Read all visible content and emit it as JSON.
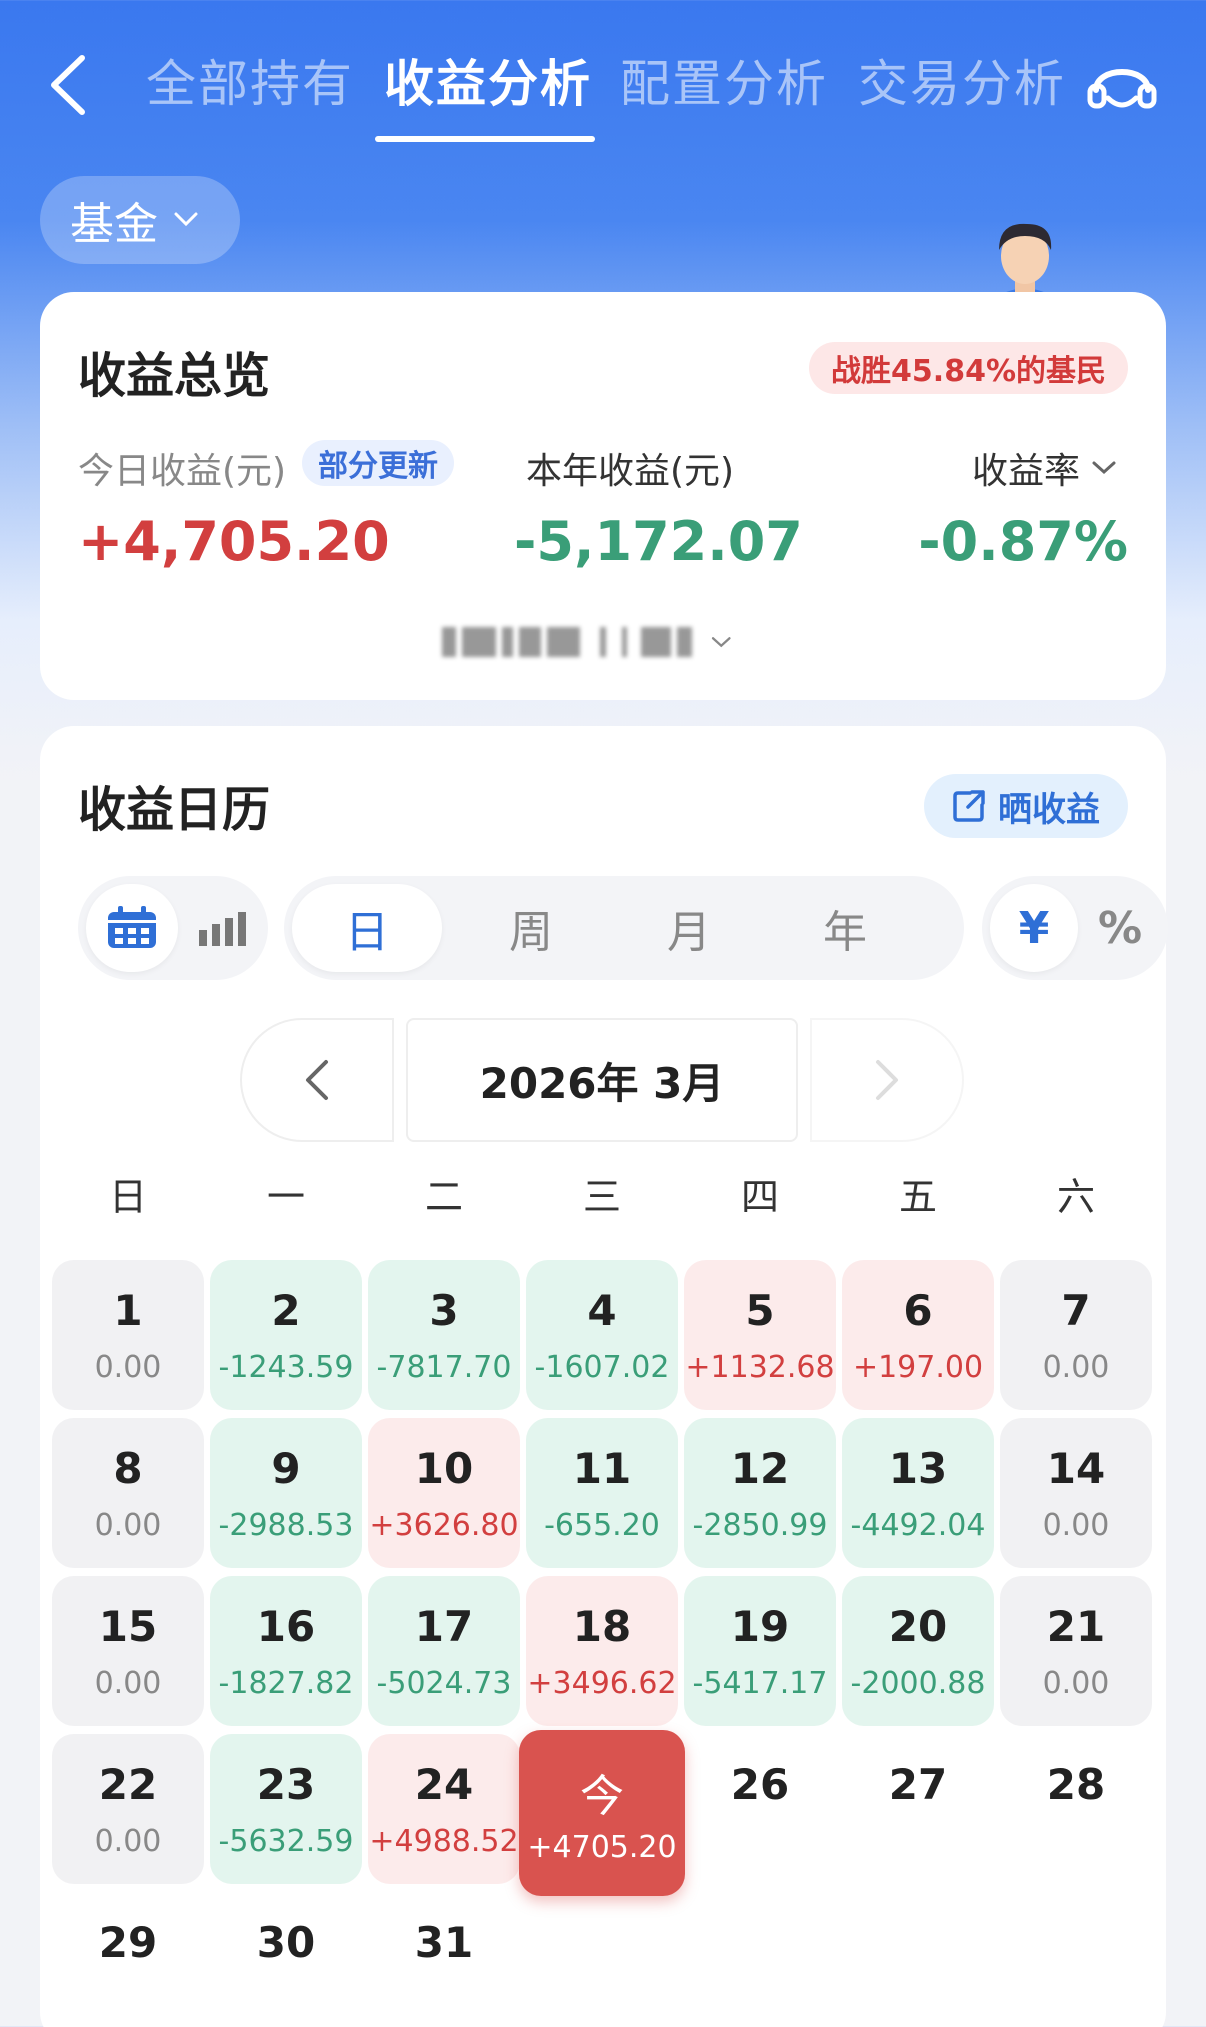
{
  "nav": {
    "tabs": [
      {
        "label": "全部持有",
        "active": false
      },
      {
        "label": "收益分析",
        "active": true
      },
      {
        "label": "配置分析",
        "active": false
      },
      {
        "label": "交易分析",
        "active": false
      }
    ],
    "icons": {
      "back": "chevron-left-icon",
      "service": "headset-icon"
    }
  },
  "filter": {
    "label": "基金"
  },
  "overview": {
    "title": "收益总览",
    "beat_badge": "战胜45.84%的基民",
    "today": {
      "label": "今日收益(元)",
      "badge": "部分更新",
      "value": "+4,705.20"
    },
    "year": {
      "label": "本年收益(元)",
      "value": "-5,172.07"
    },
    "rate": {
      "label": "收益率",
      "value": "-0.87%"
    }
  },
  "calendar": {
    "title": "收益日历",
    "share_label": "晒收益",
    "view_icons": [
      "calendar-icon",
      "bar-chart-icon"
    ],
    "periods": [
      "日",
      "周",
      "月",
      "年"
    ],
    "units": [
      "¥",
      "%"
    ],
    "month_label": "2026年 3月",
    "weekdays": [
      "日",
      "一",
      "二",
      "三",
      "四",
      "五",
      "六"
    ],
    "days": [
      {
        "d": "1",
        "v": "0.00",
        "t": "zero"
      },
      {
        "d": "2",
        "v": "-1243.59",
        "t": "loss"
      },
      {
        "d": "3",
        "v": "-7817.70",
        "t": "loss"
      },
      {
        "d": "4",
        "v": "-1607.02",
        "t": "loss"
      },
      {
        "d": "5",
        "v": "+1132.68",
        "t": "gain"
      },
      {
        "d": "6",
        "v": "+197.00",
        "t": "gain"
      },
      {
        "d": "7",
        "v": "0.00",
        "t": "zero"
      },
      {
        "d": "8",
        "v": "0.00",
        "t": "zero"
      },
      {
        "d": "9",
        "v": "-2988.53",
        "t": "loss"
      },
      {
        "d": "10",
        "v": "+3626.80",
        "t": "gain"
      },
      {
        "d": "11",
        "v": "-655.20",
        "t": "loss"
      },
      {
        "d": "12",
        "v": "-2850.99",
        "t": "loss"
      },
      {
        "d": "13",
        "v": "-4492.04",
        "t": "loss"
      },
      {
        "d": "14",
        "v": "0.00",
        "t": "zero"
      },
      {
        "d": "15",
        "v": "0.00",
        "t": "zero"
      },
      {
        "d": "16",
        "v": "-1827.82",
        "t": "loss"
      },
      {
        "d": "17",
        "v": "-5024.73",
        "t": "loss"
      },
      {
        "d": "18",
        "v": "+3496.62",
        "t": "gain"
      },
      {
        "d": "19",
        "v": "-5417.17",
        "t": "loss"
      },
      {
        "d": "20",
        "v": "-2000.88",
        "t": "loss"
      },
      {
        "d": "21",
        "v": "0.00",
        "t": "zero"
      },
      {
        "d": "22",
        "v": "0.00",
        "t": "zero"
      },
      {
        "d": "23",
        "v": "-5632.59",
        "t": "loss"
      },
      {
        "d": "24",
        "v": "+4988.52",
        "t": "gain"
      },
      {
        "d": "今",
        "v": "+4705.20",
        "t": "today"
      },
      {
        "d": "26",
        "v": "",
        "t": "future"
      },
      {
        "d": "27",
        "v": "",
        "t": "future"
      },
      {
        "d": "28",
        "v": "",
        "t": "future"
      },
      {
        "d": "29",
        "v": "",
        "t": "future"
      },
      {
        "d": "30",
        "v": "",
        "t": "future"
      },
      {
        "d": "31",
        "v": "",
        "t": "future"
      }
    ]
  },
  "colors": {
    "brand_blue": "#3a78ef",
    "gain_red": "#d23f3f",
    "loss_green": "#3a9e78",
    "today_bg": "#d9534f"
  }
}
